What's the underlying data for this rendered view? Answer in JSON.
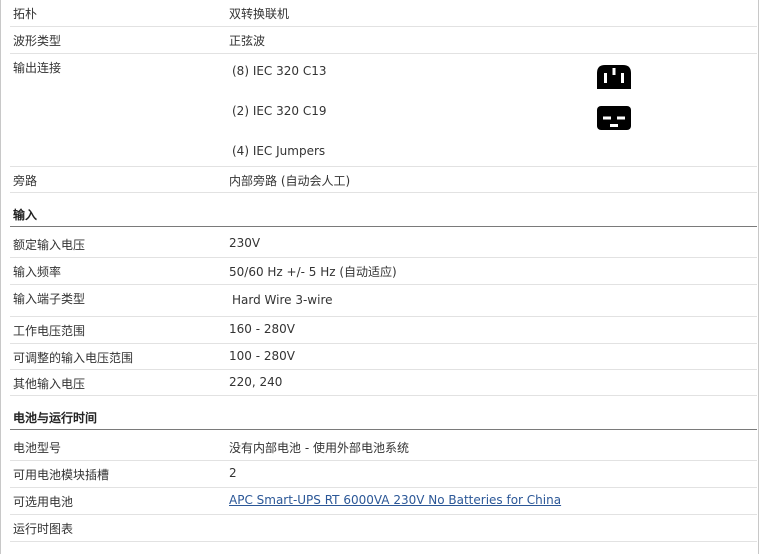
{
  "output": {
    "topology": {
      "label": "拓朴",
      "value": "双转换联机"
    },
    "waveform": {
      "label": "波形类型",
      "value": "正弦波"
    },
    "connections": {
      "label": "输出连接",
      "items": [
        "(8) IEC 320 C13",
        "(2) IEC 320 C19",
        "(4) IEC Jumpers"
      ],
      "icons": [
        "iec-c13-outlet-icon",
        "iec-c19-outlet-icon"
      ]
    },
    "bypass": {
      "label": "旁路",
      "value": "内部旁路 (自动会人工)"
    }
  },
  "input": {
    "title": "输入",
    "rows": [
      {
        "label": "额定输入电压",
        "value": "230V"
      },
      {
        "label": "输入频率",
        "value": "50/60 Hz +/- 5 Hz (自动适应)"
      },
      {
        "label": "输入端子类型",
        "value": "Hard Wire 3-wire"
      },
      {
        "label": "工作电压范围",
        "value": "160 - 280V"
      },
      {
        "label": "可调整的输入电压范围",
        "value": "100 - 280V"
      },
      {
        "label": "其他输入电压",
        "value": "220, 240"
      }
    ]
  },
  "battery": {
    "title": "电池与运行时间",
    "rows": [
      {
        "label": "电池型号",
        "value": "没有内部电池 - 使用外部电池系统"
      },
      {
        "label": "可用电池模块插槽",
        "value": "2"
      },
      {
        "label": "可选用电池",
        "value": "APC Smart-UPS RT 6000VA 230V No Batteries for China"
      },
      {
        "label": "运行时图表",
        "value": ""
      }
    ]
  },
  "colors": {
    "link": "#2b5797",
    "section_rule": "#7a7a7a",
    "row_rule": "#e2e2e2"
  }
}
